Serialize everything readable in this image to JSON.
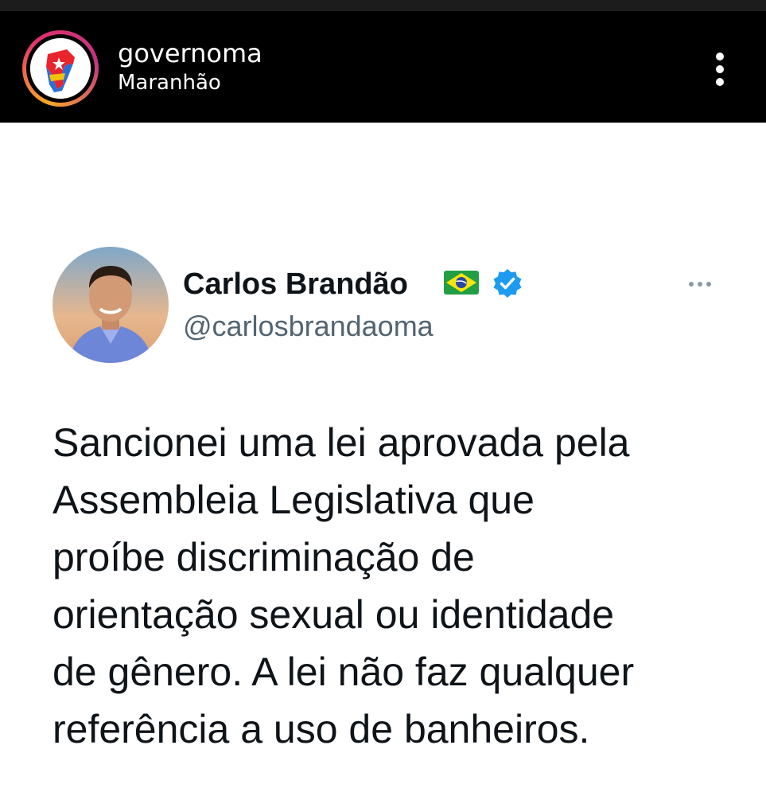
{
  "instagram": {
    "username": "governoma",
    "location": "Maranhão",
    "menu_icon": "more-vertical-icon"
  },
  "tweet": {
    "author_name": "Carlos Brandão",
    "author_handle": "@carlosbrandaoma",
    "flag_icon": "brazil-flag-icon",
    "verified_icon": "verified-badge-icon",
    "more_icon": "more-horizontal-icon",
    "text": "Sancionei uma lei aprovada pela\nAssembleia Legislativa que\nproíbe discriminação de\norientação sexual ou identidade\nde gênero. A lei não faz qualquer\nreferência a uso de banheiros."
  },
  "colors": {
    "header_bg": "#000000",
    "text_primary": "#0f1419",
    "text_secondary": "#536471",
    "verified_blue": "#1d9bf0"
  }
}
